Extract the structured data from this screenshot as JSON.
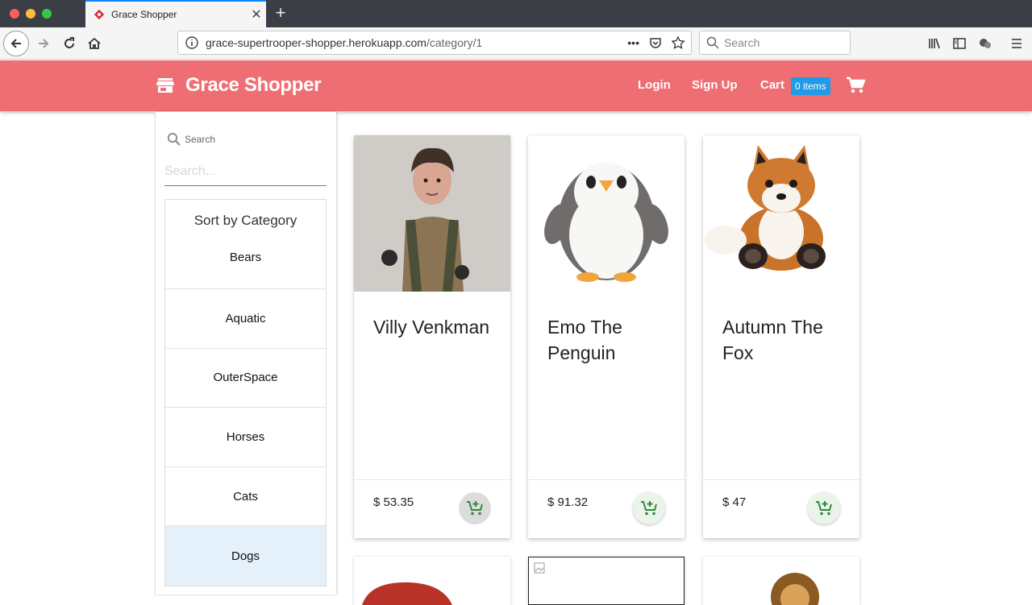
{
  "browser": {
    "tab_title": "Grace Shopper",
    "url_host": "grace-supertrooper-shopper.herokuapp.com",
    "url_path": "/category/1",
    "search_placeholder": "Search"
  },
  "app": {
    "brand": "Grace Shopper",
    "nav": {
      "login": "Login",
      "signup": "Sign Up",
      "cart": "Cart",
      "cart_count": "0 items"
    },
    "accent_color": "#ef6e73"
  },
  "sidebar": {
    "search_label": "Search",
    "search_placeholder": "Search...",
    "category_heading": "Sort by Category",
    "categories": [
      {
        "label": "Bears"
      },
      {
        "label": "Aquatic"
      },
      {
        "label": "OuterSpace"
      },
      {
        "label": "Horses"
      },
      {
        "label": "Cats"
      },
      {
        "label": "Dogs",
        "selected": true
      }
    ]
  },
  "products": [
    {
      "name": "Villy Venkman",
      "price": "$ 53.35",
      "image": "crochet-doll"
    },
    {
      "name": "Emo The Penguin",
      "price": "$ 91.32",
      "image": "penguin-plush"
    },
    {
      "name": "Autumn The Fox",
      "price": "$ 47",
      "image": "fox-plush"
    }
  ]
}
